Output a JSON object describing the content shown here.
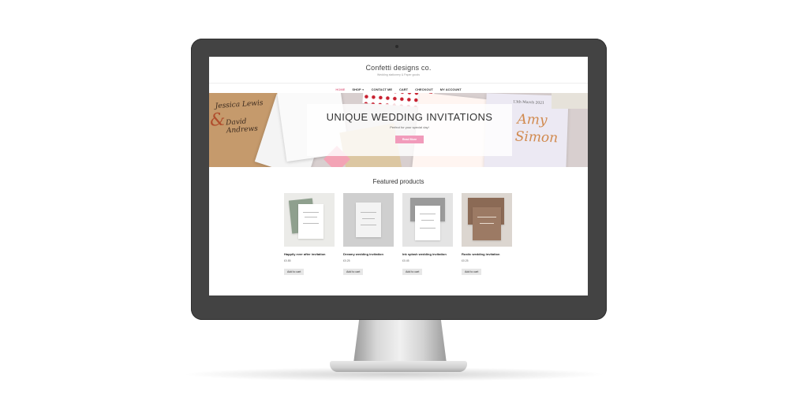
{
  "site": {
    "title": "Confetti designs co.",
    "tagline": "Wedding stationery & Paper goods"
  },
  "nav": {
    "items": [
      {
        "label": "HOME",
        "active": true
      },
      {
        "label": "SHOP",
        "has_dropdown": true
      },
      {
        "label": "CONTACT ME"
      },
      {
        "label": "CART"
      },
      {
        "label": "CHECKOUT"
      },
      {
        "label": "MY ACCOUNT"
      }
    ],
    "dropdown_icon": "chevron-down-icon"
  },
  "hero": {
    "heading": "UNIQUE WEDDING INVITATIONS",
    "subheading": "Perfect for your special day!",
    "button_label": "Read More",
    "background_text": {
      "names_left_1": "Jessica Lewis",
      "names_left_2": "David Andrews",
      "names_right_1": "Amy",
      "names_right_2": "Simon",
      "date": "13th March 2021",
      "ampersand": "&"
    }
  },
  "featured": {
    "title": "Featured products",
    "products": [
      {
        "name": "Happily ever after invitation",
        "price": "£0.85",
        "button": "Add to cart"
      },
      {
        "name": "Dreamy wedding invitation",
        "price": "£0.25",
        "button": "Add to cart"
      },
      {
        "name": "Ink splash wedding invitation",
        "price": "£0.45",
        "button": "Add to cart"
      },
      {
        "name": "Rustic wedding invitation",
        "price": "£0.25",
        "button": "Add to cart"
      }
    ]
  },
  "colors": {
    "accent_pink": "#f19bbb",
    "nav_active": "#e37a96",
    "bezel": "#434343"
  }
}
